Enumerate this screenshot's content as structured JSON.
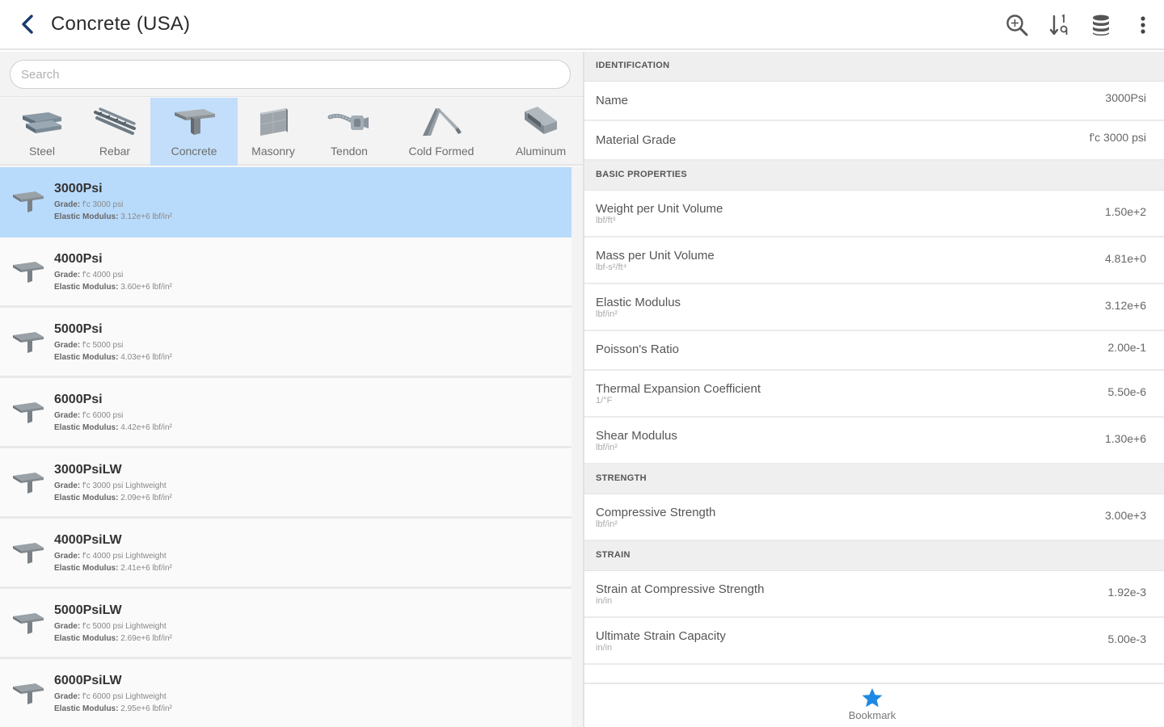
{
  "header": {
    "title": "Concrete (USA)",
    "back_icon": "chevron-left-icon",
    "actions": [
      {
        "name": "zoom-search-icon"
      },
      {
        "name": "sort-icon"
      },
      {
        "name": "database-icon"
      },
      {
        "name": "more-vertical-icon"
      }
    ]
  },
  "search": {
    "placeholder": "Search",
    "value": ""
  },
  "categories": [
    {
      "label": "Steel",
      "active": false
    },
    {
      "label": "Rebar",
      "active": false
    },
    {
      "label": "Concrete",
      "active": true
    },
    {
      "label": "Masonry",
      "active": false
    },
    {
      "label": "Tendon",
      "active": false
    },
    {
      "label": "Cold Formed",
      "active": false
    },
    {
      "label": "Aluminum",
      "active": false
    }
  ],
  "materials": [
    {
      "name": "3000Psi",
      "grade_label": "Grade:",
      "grade": "f'c 3000 psi",
      "modulus_label": "Elastic Modulus:",
      "modulus": "3.12e+6 lbf/in²",
      "selected": true
    },
    {
      "name": "4000Psi",
      "grade_label": "Grade:",
      "grade": "f'c 4000 psi",
      "modulus_label": "Elastic Modulus:",
      "modulus": "3.60e+6 lbf/in²",
      "selected": false
    },
    {
      "name": "5000Psi",
      "grade_label": "Grade:",
      "grade": "f'c 5000 psi",
      "modulus_label": "Elastic Modulus:",
      "modulus": "4.03e+6 lbf/in²",
      "selected": false
    },
    {
      "name": "6000Psi",
      "grade_label": "Grade:",
      "grade": "f'c 6000 psi",
      "modulus_label": "Elastic Modulus:",
      "modulus": "4.42e+6 lbf/in²",
      "selected": false
    },
    {
      "name": "3000PsiLW",
      "grade_label": "Grade:",
      "grade": "f'c 3000 psi Lightweight",
      "modulus_label": "Elastic Modulus:",
      "modulus": "2.09e+6 lbf/in²",
      "selected": false
    },
    {
      "name": "4000PsiLW",
      "grade_label": "Grade:",
      "grade": "f'c 4000 psi Lightweight",
      "modulus_label": "Elastic Modulus:",
      "modulus": "2.41e+6 lbf/in²",
      "selected": false
    },
    {
      "name": "5000PsiLW",
      "grade_label": "Grade:",
      "grade": "f'c 5000 psi Lightweight",
      "modulus_label": "Elastic Modulus:",
      "modulus": "2.69e+6 lbf/in²",
      "selected": false
    },
    {
      "name": "6000PsiLW",
      "grade_label": "Grade:",
      "grade": "f'c 6000 psi Lightweight",
      "modulus_label": "Elastic Modulus:",
      "modulus": "2.95e+6 lbf/in²",
      "selected": false
    }
  ],
  "details": {
    "identification": {
      "header": "IDENTIFICATION",
      "rows": [
        {
          "label": "Name",
          "value": "3000Psi"
        },
        {
          "label": "Material Grade",
          "value": "f'c 3000 psi"
        }
      ]
    },
    "basic": {
      "header": "BASIC PROPERTIES",
      "rows": [
        {
          "label": "Weight per Unit Volume",
          "unit": "lbf/ft³",
          "value": "1.50e+2"
        },
        {
          "label": "Mass per Unit Volume",
          "unit": "lbf-s²/ft⁴",
          "value": "4.81e+0"
        },
        {
          "label": "Elastic Modulus",
          "unit": "lbf/in²",
          "value": "3.12e+6"
        },
        {
          "label": "Poisson's Ratio",
          "value": "2.00e-1"
        },
        {
          "label": "Thermal Expansion Coefficient",
          "unit": "1/°F",
          "value": "5.50e-6"
        },
        {
          "label": "Shear Modulus",
          "unit": "lbf/in²",
          "value": "1.30e+6"
        }
      ]
    },
    "strength": {
      "header": "STRENGTH",
      "rows": [
        {
          "label": "Compressive Strength",
          "unit": "lbf/in²",
          "value": "3.00e+3"
        }
      ]
    },
    "strain": {
      "header": "STRAIN",
      "rows": [
        {
          "label": "Strain at Compressive Strength",
          "unit": "in/in",
          "value": "1.92e-3"
        },
        {
          "label": "Ultimate Strain Capacity",
          "unit": "in/in",
          "value": "5.00e-3"
        }
      ]
    }
  },
  "footer": {
    "bookmark_label": "Bookmark",
    "bookmark_icon": "star-icon"
  },
  "colors": {
    "accent": "#1e88e5",
    "selected_bg": "#b9dbfb",
    "section_bg": "#efefef"
  }
}
